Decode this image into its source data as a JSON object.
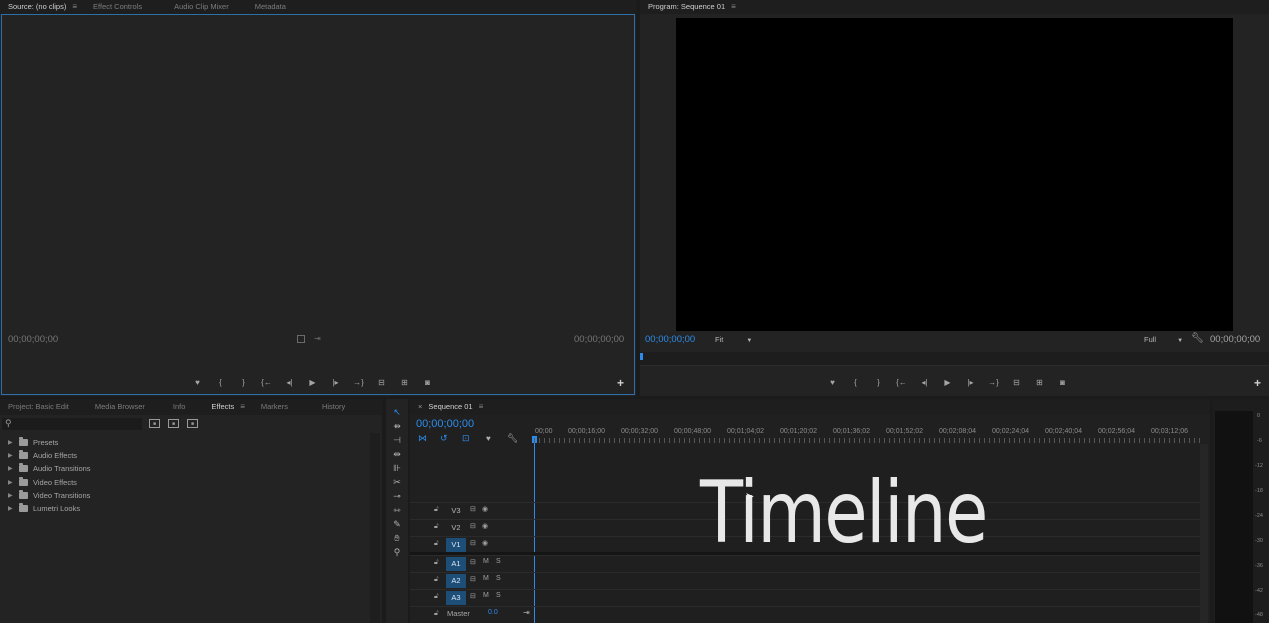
{
  "source_panel": {
    "tabs": [
      {
        "label": "Source: (no clips)",
        "active": true
      },
      {
        "label": "Effect Controls",
        "active": false
      },
      {
        "label": "Audio Clip Mixer",
        "active": false
      },
      {
        "label": "Metadata",
        "active": false
      }
    ],
    "timecode_left": "00;00;00;00",
    "timecode_right": "00;00;00;00"
  },
  "program_panel": {
    "tab": "Program: Sequence 01",
    "timecode_left": "00;00;00;00",
    "fit_label": "Fit",
    "full_label": "Full",
    "timecode_right": "00;00;00;00"
  },
  "project_panel": {
    "tabs": [
      {
        "label": "Project: Basic Edit",
        "active": false
      },
      {
        "label": "Media Browser",
        "active": false
      },
      {
        "label": "Info",
        "active": false
      },
      {
        "label": "Effects",
        "active": true
      },
      {
        "label": "Markers",
        "active": false
      },
      {
        "label": "History",
        "active": false
      }
    ],
    "tree": [
      {
        "label": "Presets"
      },
      {
        "label": "Audio Effects"
      },
      {
        "label": "Audio Transitions"
      },
      {
        "label": "Video Effects"
      },
      {
        "label": "Video Transitions"
      },
      {
        "label": "Lumetri Looks"
      }
    ]
  },
  "timeline": {
    "tab": "Sequence 01",
    "timecode": "00;00;00;00",
    "ruler": [
      "00;00",
      "00;00;16;00",
      "00;00;32;00",
      "00;00;48;00",
      "00;01;04;02",
      "00;01;20;02",
      "00;01;36;02",
      "00;01;52;02",
      "00;02;08;04",
      "00;02;24;04",
      "00;02;40;04",
      "00;02;56;04",
      "00;03;12;06"
    ],
    "overlay_title": "Timeline",
    "video_tracks": [
      {
        "label": "V3",
        "on": false
      },
      {
        "label": "V2",
        "on": false
      },
      {
        "label": "V1",
        "on": true
      }
    ],
    "audio_tracks": [
      {
        "label": "A1",
        "m": "M",
        "s": "S"
      },
      {
        "label": "A2",
        "m": "M",
        "s": "S"
      },
      {
        "label": "A3",
        "m": "M",
        "s": "S"
      }
    ],
    "master_label": "Master",
    "master_value": "0.0"
  },
  "meter": {
    "scale": [
      "0",
      "-6",
      "-12",
      "-18",
      "-24",
      "-30",
      "-36",
      "-42",
      "-48"
    ]
  },
  "colors": {
    "accent_blue": "#2d8ceb",
    "track_active": "#1d4e78"
  }
}
